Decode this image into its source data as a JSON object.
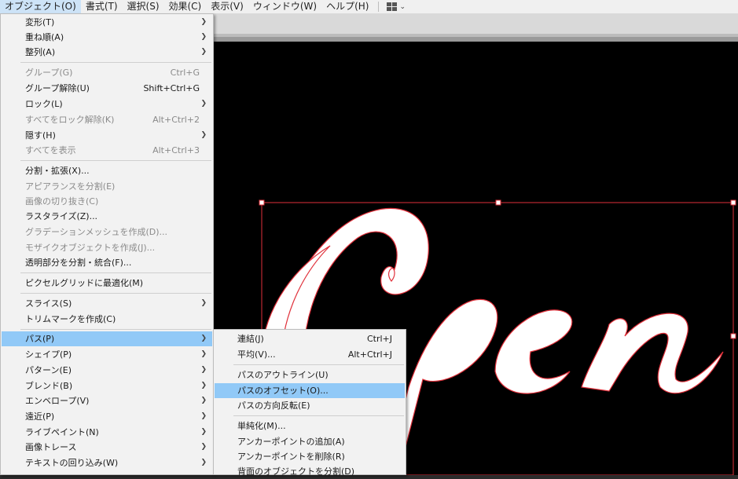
{
  "menubar": {
    "items": [
      {
        "label": "オブジェクト(O)",
        "active": true
      },
      {
        "label": "書式(T)"
      },
      {
        "label": "選択(S)"
      },
      {
        "label": "効果(C)"
      },
      {
        "label": "表示(V)"
      },
      {
        "label": "ウィンドウ(W)"
      },
      {
        "label": "ヘルプ(H)"
      }
    ],
    "workspace_icon": "workspace-grid-icon"
  },
  "object_menu": {
    "items": [
      {
        "label": "変形(T)",
        "submenu": true
      },
      {
        "label": "重ね順(A)",
        "submenu": true
      },
      {
        "label": "整列(A)",
        "submenu": true
      },
      {
        "label": "グループ(G)",
        "shortcut": "Ctrl+G",
        "disabled": true
      },
      {
        "label": "グループ解除(U)",
        "shortcut": "Shift+Ctrl+G"
      },
      {
        "label": "ロック(L)",
        "submenu": true
      },
      {
        "label": "すべてをロック解除(K)",
        "shortcut": "Alt+Ctrl+2",
        "disabled": true
      },
      {
        "label": "隠す(H)",
        "submenu": true
      },
      {
        "label": "すべてを表示",
        "shortcut": "Alt+Ctrl+3",
        "disabled": true
      },
      {
        "label": "分割・拡張(X)..."
      },
      {
        "label": "アピアランスを分割(E)",
        "disabled": true
      },
      {
        "label": "画像の切り抜き(C)",
        "disabled": true
      },
      {
        "label": "ラスタライズ(Z)..."
      },
      {
        "label": "グラデーションメッシュを作成(D)...",
        "disabled": true
      },
      {
        "label": "モザイクオブジェクトを作成(J)...",
        "disabled": true
      },
      {
        "label": "透明部分を分割・統合(F)..."
      },
      {
        "label": "ピクセルグリッドに最適化(M)"
      },
      {
        "label": "スライス(S)",
        "submenu": true
      },
      {
        "label": "トリムマークを作成(C)"
      },
      {
        "label": "パス(P)",
        "submenu": true,
        "highlighted": true
      },
      {
        "label": "シェイプ(P)",
        "submenu": true
      },
      {
        "label": "パターン(E)",
        "submenu": true
      },
      {
        "label": "ブレンド(B)",
        "submenu": true
      },
      {
        "label": "エンベロープ(V)",
        "submenu": true
      },
      {
        "label": "遠近(P)",
        "submenu": true
      },
      {
        "label": "ライブペイント(N)",
        "submenu": true
      },
      {
        "label": "画像トレース",
        "submenu": true
      },
      {
        "label": "テキストの回り込み(W)",
        "submenu": true
      }
    ]
  },
  "path_submenu": {
    "items": [
      {
        "label": "連結(J)",
        "shortcut": "Ctrl+J"
      },
      {
        "label": "平均(V)...",
        "shortcut": "Alt+Ctrl+J"
      },
      {
        "label": "パスのアウトライン(U)"
      },
      {
        "label": "パスのオフセット(O)...",
        "highlighted": true
      },
      {
        "label": "パスの方向反転(E)"
      },
      {
        "label": "単純化(M)..."
      },
      {
        "label": "アンカーポイントの追加(A)"
      },
      {
        "label": "アンカーポイントを削除(R)"
      },
      {
        "label": "背面のオブジェクトを分割(D)"
      }
    ]
  },
  "colors": {
    "menu_bg": "#f2f2f2",
    "highlight": "#91c9f7",
    "canvas": "#000000",
    "selection": "#e0303a"
  }
}
